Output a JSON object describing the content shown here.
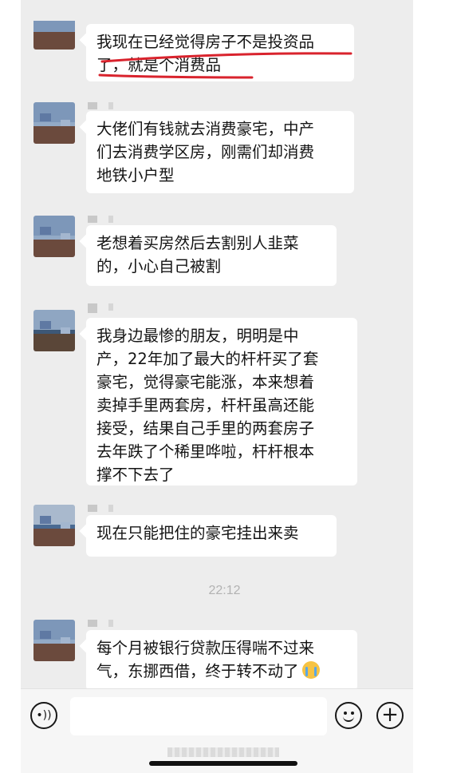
{
  "messages": [
    {
      "lines": [
        "我现在已经觉得房子不是投资品",
        "了，就是个消费品"
      ]
    },
    {
      "lines": [
        "大佬们有钱就去消费豪宅，中产",
        "们去消费学区房，刚需们却消费",
        "地铁小户型"
      ]
    },
    {
      "lines": [
        "老想着买房然后去割别人韭菜",
        "的，小心自己被割"
      ]
    },
    {
      "lines": [
        "我身边最惨的朋友，明明是中",
        "产，22年加了最大的杆杆买了套",
        "豪宅，觉得豪宅能涨，本来想着",
        "卖掉手里两套房，杆杆虽高还能",
        "接受，结果自己手里的两套房子",
        "去年跌了个稀里哗啦，杆杆根本",
        "撑不下去了"
      ]
    },
    {
      "lines": [
        "现在只能把住的豪宅挂出来卖"
      ]
    },
    {
      "lines": [
        "每个月被银行贷款压得喘不过来",
        "气，东挪西借，终于转不动了"
      ]
    }
  ],
  "timestamp": "22:12",
  "emoji": "crying-face-icon",
  "input": {
    "value": ""
  },
  "colors": {
    "background": "#ededed",
    "bubble": "#ffffff",
    "timestamp": "#b2b2b2",
    "underline": "#d9232d"
  }
}
